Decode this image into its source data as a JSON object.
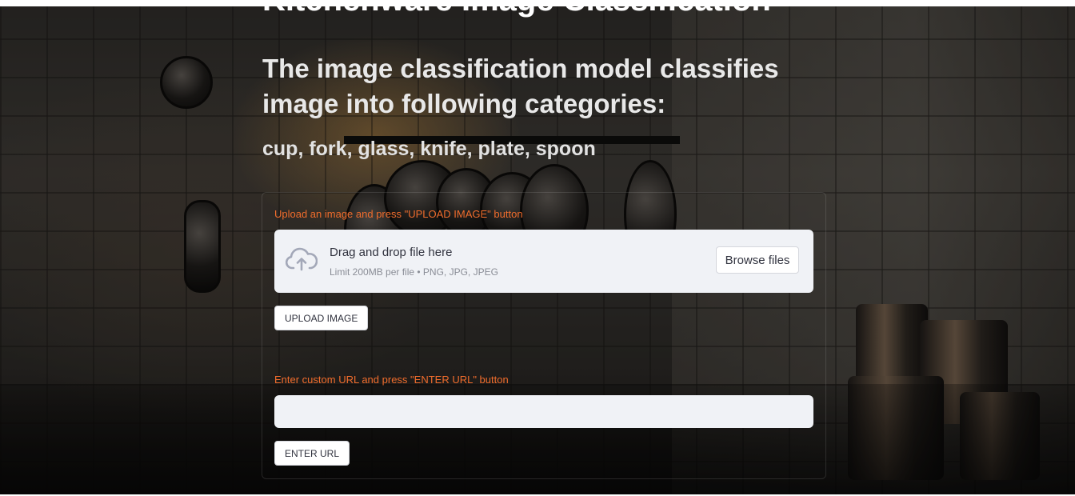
{
  "app": {
    "title": "Kitchenware Image Classification",
    "subtitle": "The image classification model classifies image into following categories:",
    "categories": "cup, fork, glass, knife, plate, spoon"
  },
  "upload": {
    "label": "Upload an image and press \"UPLOAD IMAGE\" button",
    "dropzone_title": "Drag and drop file here",
    "dropzone_limit": "Limit 200MB per file • PNG, JPG, JPEG",
    "browse_label": "Browse files",
    "icon": "cloud-upload-icon",
    "button_label": "UPLOAD IMAGE"
  },
  "url": {
    "label": "Enter custom URL and press \"ENTER URL\" button",
    "value": "",
    "placeholder": "",
    "button_label": "ENTER URL"
  },
  "colors": {
    "label_accent": "#ef6c2c",
    "field_bg": "#f0f2f6",
    "heading": "#ffffff"
  }
}
